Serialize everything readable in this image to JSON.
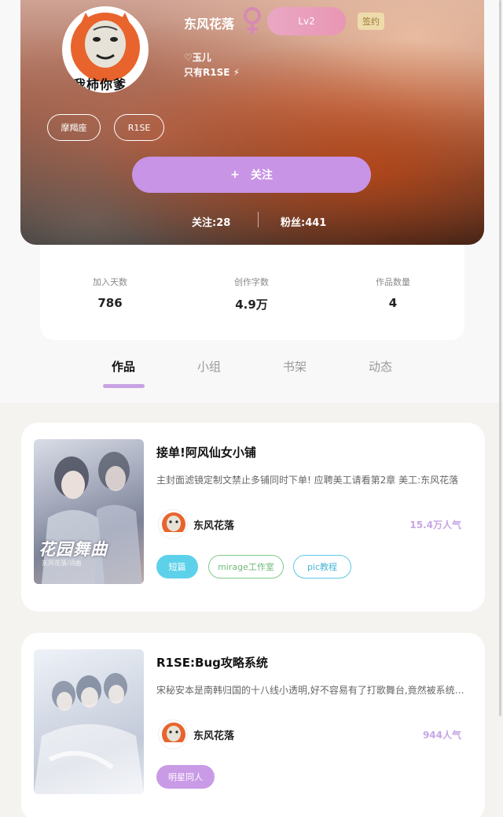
{
  "profile": {
    "name": "东风花落",
    "level": "Lv2",
    "sign_badge": "签约",
    "avatar_text": "我柿你爹",
    "bio": [
      "♡玉儿",
      "只有R1SE ⚡"
    ],
    "tags": [
      "摩羯座",
      "R1SE"
    ],
    "follow_button": "关注",
    "follow_plus": "+",
    "following": "关注:28",
    "fans": "粉丝:441"
  },
  "stats": [
    {
      "label": "加入天数",
      "value": "786"
    },
    {
      "label": "创作字数",
      "value": "4.9万"
    },
    {
      "label": "作品数量",
      "value": "4"
    }
  ],
  "tabs": [
    "作品",
    "小组",
    "书架",
    "动态"
  ],
  "books": [
    {
      "title": "接单!阿风仙女小铺",
      "description": "主封面滤镜定制文禁止多铺同时下单! 应聘美工请看第2章 美工:东风花落",
      "author": "东风花落",
      "popularity": "15.4万人气",
      "cover_text": "花园舞曲",
      "cover_sub": "东风花落/词曲",
      "chips": [
        "短篇",
        "mirage工作室",
        "pic教程"
      ]
    },
    {
      "title": "R1SE:Bug攻略系统",
      "description": "宋秘安本是南韩归国的十八线小透明,好不容易有了打歌舞台,竟然被系统绑定",
      "author": "东风花落",
      "popularity": "944人气",
      "chips": [
        "明星同人"
      ]
    }
  ],
  "colors": {
    "accent": "#c894e6",
    "popularity": "#c8a6e6",
    "chip_blue_fill": "#5dd1ea",
    "chip_green": "#7fc98a",
    "chip_blue_outline": "#5dc8e6",
    "chip_purple_fill": "#c99ae6"
  }
}
